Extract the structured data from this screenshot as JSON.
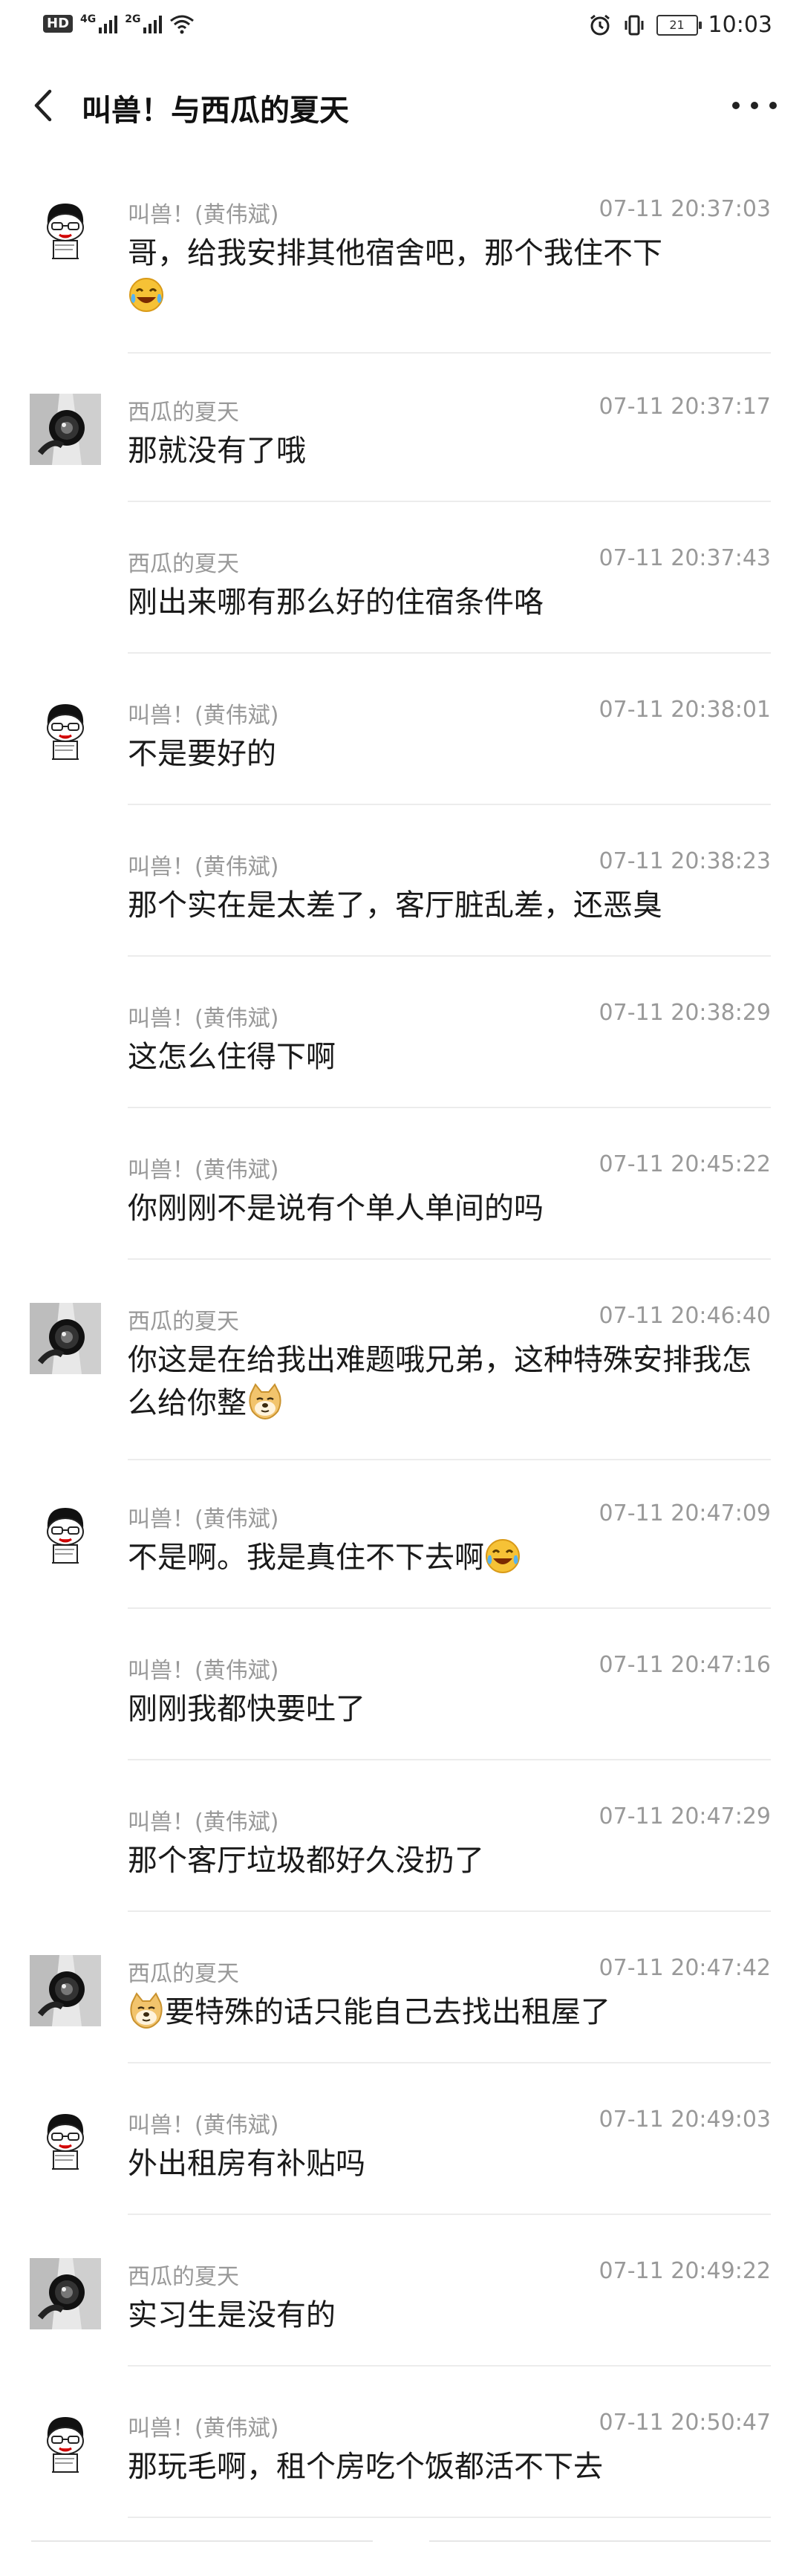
{
  "status_bar": {
    "hd": "HD",
    "net1": "4G",
    "net2": "2G",
    "battery": "21",
    "time": "10:03"
  },
  "header": {
    "title": "叫兽！与西瓜的夏天"
  },
  "messages": [
    {
      "sender": "叫兽！(黄伟斌)",
      "time": "07-11 20:37:03",
      "text": "哥，给我安排其他宿舍吧，那个我住不下",
      "avatar": "cartoon"
    },
    {
      "sender": "西瓜的夏天",
      "time": "07-11 20:37:17",
      "text": "那就没有了哦",
      "avatar": "camera"
    },
    {
      "sender": "西瓜的夏天",
      "time": "07-11 20:37:43",
      "text": "刚出来哪有那么好的住宿条件咯",
      "avatar": ""
    },
    {
      "sender": "叫兽！(黄伟斌)",
      "time": "07-11 20:38:01",
      "text": "不是要好的",
      "avatar": "cartoon"
    },
    {
      "sender": "叫兽！(黄伟斌)",
      "time": "07-11 20:38:23",
      "text": "那个实在是太差了，客厅脏乱差，还恶臭",
      "avatar": ""
    },
    {
      "sender": "叫兽！(黄伟斌)",
      "time": "07-11 20:38:29",
      "text": "这怎么住得下啊",
      "avatar": ""
    },
    {
      "sender": "叫兽！(黄伟斌)",
      "time": "07-11 20:45:22",
      "text": "你刚刚不是说有个单人单间的吗",
      "avatar": ""
    },
    {
      "sender": "西瓜的夏天",
      "time": "07-11 20:46:40",
      "text": "你这是在给我出难题哦兄弟，这种特殊安排我怎么给你整",
      "avatar": "camera"
    },
    {
      "sender": "叫兽！(黄伟斌)",
      "time": "07-11 20:47:09",
      "text": "不是啊。我是真住不下去啊",
      "avatar": "cartoon"
    },
    {
      "sender": "叫兽！(黄伟斌)",
      "time": "07-11 20:47:16",
      "text": "刚刚我都快要吐了",
      "avatar": ""
    },
    {
      "sender": "叫兽！(黄伟斌)",
      "time": "07-11 20:47:29",
      "text": "那个客厅垃圾都好久没扔了",
      "avatar": ""
    },
    {
      "sender": "西瓜的夏天",
      "time": "07-11 20:47:42",
      "text": "要特殊的话只能自己去找出租屋了",
      "avatar": "camera"
    },
    {
      "sender": "叫兽！(黄伟斌)",
      "time": "07-11 20:49:03",
      "text": "外出租房有补贴吗",
      "avatar": "cartoon"
    },
    {
      "sender": "西瓜的夏天",
      "time": "07-11 20:49:22",
      "text": "实习生是没有的",
      "avatar": "camera"
    },
    {
      "sender": "叫兽！(黄伟斌)",
      "time": "07-11 20:50:47",
      "text": "那玩毛啊，租个房吃个饭都活不下去",
      "avatar": "cartoon"
    }
  ]
}
